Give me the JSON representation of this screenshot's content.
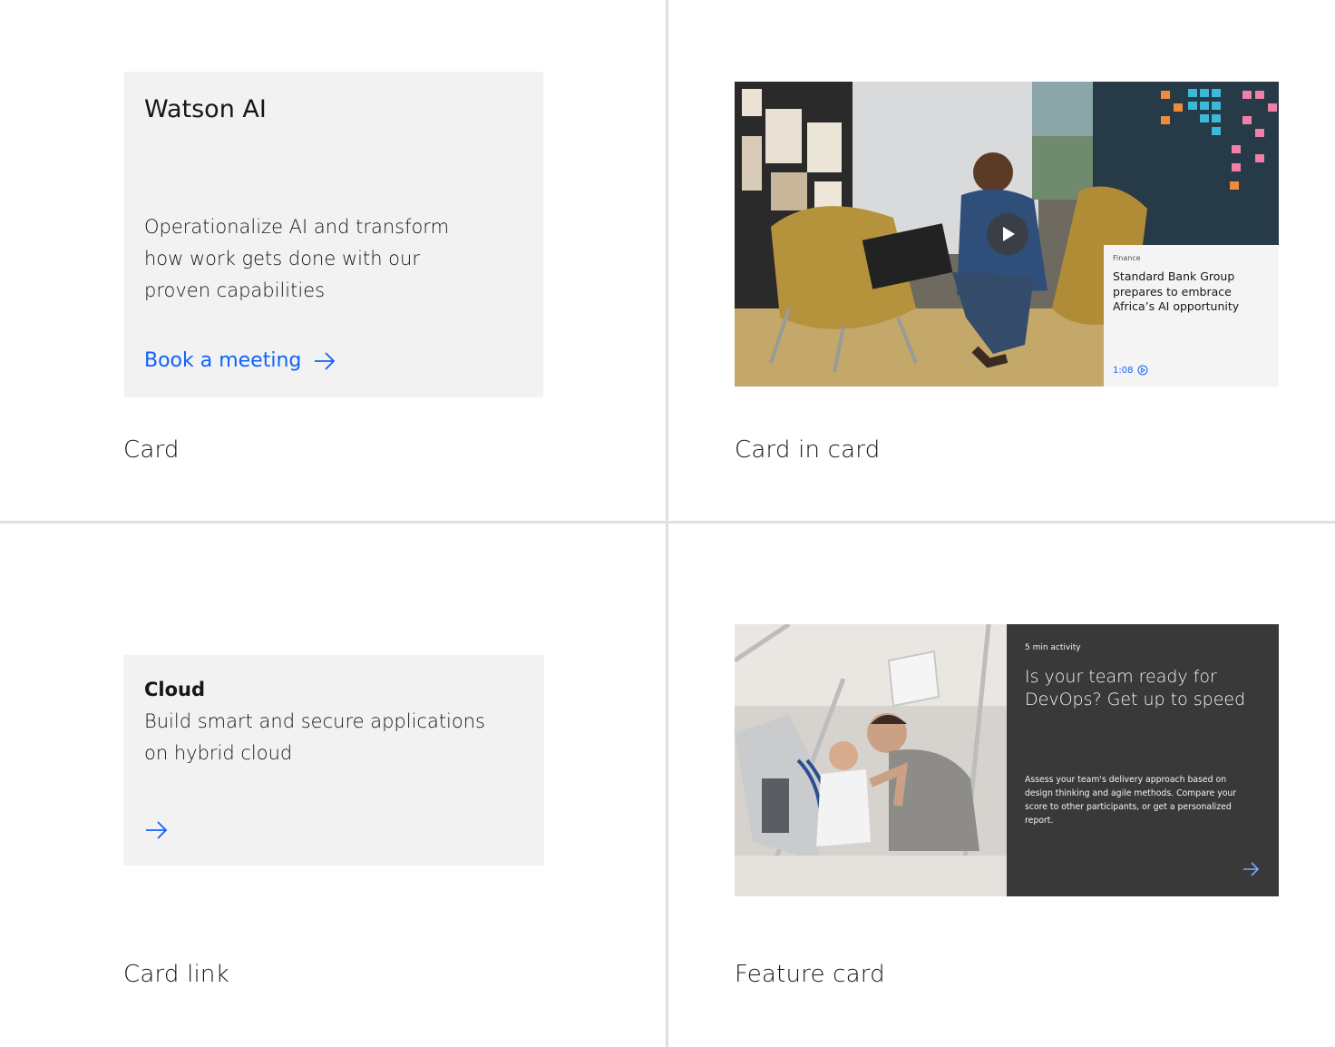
{
  "card": {
    "heading": "Watson AI",
    "copy": "Operationalize AI and transform how work gets done with our proven capabilities",
    "cta_label": "Book a meeting",
    "caption": "Card"
  },
  "card_in_card": {
    "eyebrow": "Finance",
    "title": "Standard Bank Group prepares to embrace Africa’s AI opportunity",
    "duration": "1:08",
    "caption": "Card in card"
  },
  "card_link": {
    "heading": "Cloud",
    "copy": "Build smart and secure applications on hybrid cloud",
    "caption": "Card link"
  },
  "feature_card": {
    "eyebrow": "5 min activity",
    "title": "Is your team ready for DevOps? Get up to speed",
    "copy": "Assess your team's delivery approach based on design thinking and agile methods. Compare your score to other participants, or get a personalized report.",
    "caption": "Feature card"
  },
  "colors": {
    "link_blue": "#0f62fe",
    "card_gray": "#f2f2f2",
    "feature_dark": "#393939",
    "divider": "#e0e0e0"
  },
  "icons": [
    "arrow-right-icon",
    "play-icon",
    "play-circle-icon"
  ]
}
